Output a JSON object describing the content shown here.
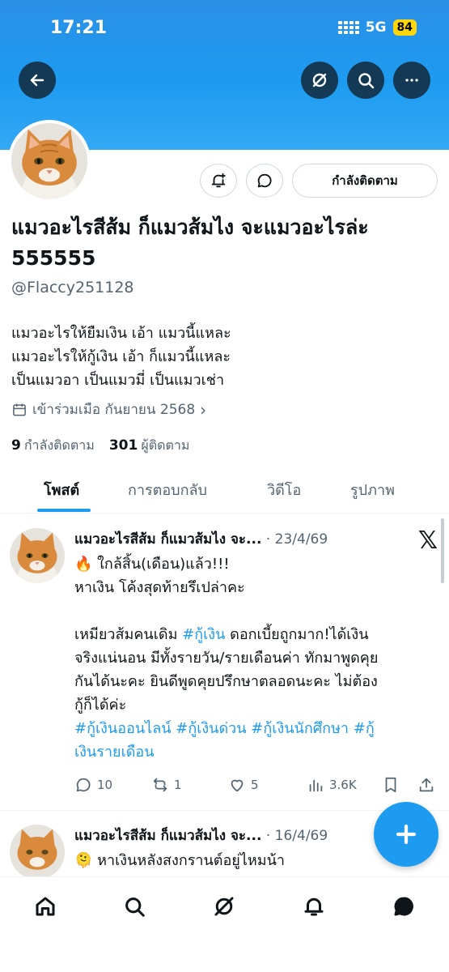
{
  "status_bar": {
    "time": "17:21",
    "network": "5G",
    "battery": "84"
  },
  "header": {
    "back_icon": "arrow-left-icon",
    "grok_icon": "grok-icon",
    "search_icon": "search-icon",
    "more_icon": "more-horizontal-icon"
  },
  "profile": {
    "display_name": "แมวอะไรสีส้ม ก็แมวส้มไง จะแมวอะไรล่ะ 555555",
    "handle": "@Flaccy251128",
    "follow_button": "กำลังติดตาม",
    "bio_lines": [
      "แมวอะไรให้ยืมเงิน เอ้า แมวนี้แหละ",
      "แมวอะไรให้กู้เงิน เอ้า ก็แมวนี้แหละ",
      "เป็นแมวอา เป็นแมวมี่ เป็นแมวเช่า"
    ],
    "joined": "เข้าร่วมเมือ กันยายน 2568",
    "following_count": "9",
    "following_label": "กำลังติดตาม",
    "followers_count": "301",
    "followers_label": "ผู้ติดตาม"
  },
  "tabs": [
    "โพสต์",
    "การตอบกลับ",
    "วิดีโอ",
    "รูปภาพ"
  ],
  "posts": [
    {
      "author": "แมวอะไรสีส้ม ก็แมวส้มไง จะ...",
      "date": "· 23/4/69",
      "lines": [
        "🔥 ใกล้สิ้น(เดือน)แล้ว!!!",
        "หาเงิน โค้งสุดท้ายรึเปล่าคะ",
        "",
        "เหมียวส้มคนเดิม ",
        "#กู้เงิน",
        " ดอกเบี้ยถูกมาก!ได้เงิน",
        "จริงแน่นอน มีทั้งรายวัน/รายเดือนค่า ทักมาพูดคุย",
        "กันได้นะคะ ยินดีพูดคุยปรึกษาตลอดนะคะ ไม่ต้อง",
        "กู้ก็ได้ค่ะ",
        "#กู้เงินออนไลน์ #กู้เงินด่วน #กู้เงินนักศึกษา #กู้",
        "เงินรายเดือน"
      ],
      "replies": "10",
      "reposts": "1",
      "likes": "5",
      "views": "3.6K"
    },
    {
      "author": "แมวอะไรสีส้ม ก็แมวส้มไง จะ...",
      "date": "· 16/4/69",
      "lines": [
        "🫠 หาเงินหลังสงกรานต์อยู่ไหมน้า"
      ]
    }
  ],
  "colors": {
    "accent": "#1d9bf0",
    "text": "#0f1419",
    "muted": "#536471",
    "banner": "#1d9bf0"
  }
}
